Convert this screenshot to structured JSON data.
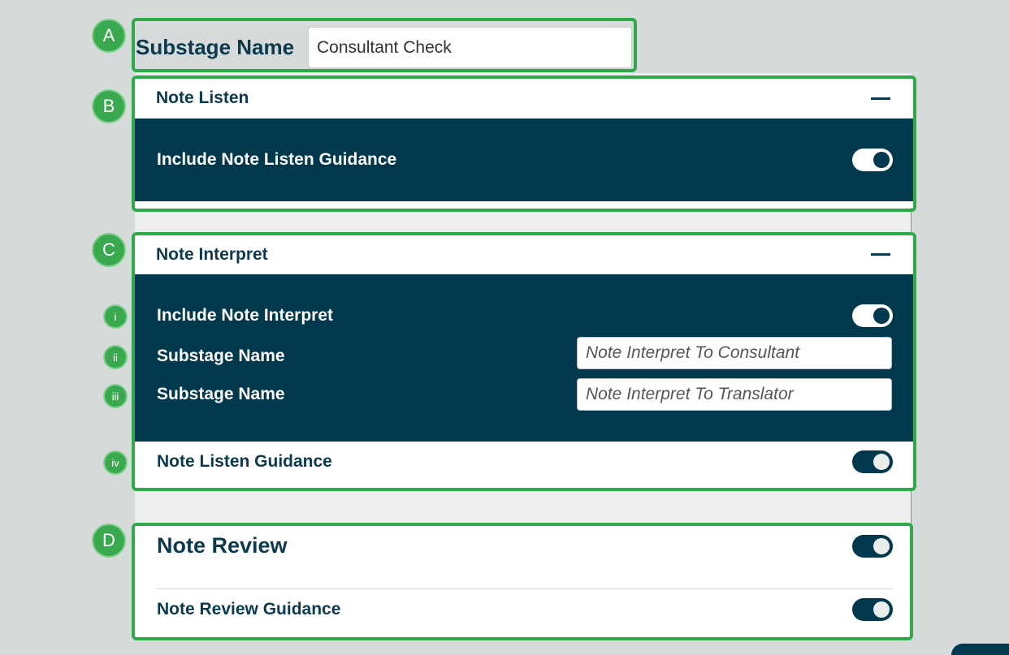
{
  "annotations": {
    "a": "A",
    "b": "B",
    "c": "C",
    "d": "D",
    "c_i": "i",
    "c_ii": "ii",
    "c_iii": "iii",
    "c_iv": "iv"
  },
  "substage": {
    "label": "Substage Name",
    "value": "Consultant Check"
  },
  "note_listen": {
    "title": "Note Listen",
    "toggle_label": "Include Note Listen Guidance",
    "toggle_on": true
  },
  "note_interpret": {
    "title": "Note Interpret",
    "include_label": "Include Note Interpret",
    "include_on": true,
    "substage1_label": "Substage Name",
    "substage1_placeholder": "Note Interpret To Consultant",
    "substage2_label": "Substage Name",
    "substage2_placeholder": "Note Interpret To Translator",
    "guidance_label": "Note Listen Guidance",
    "guidance_on": true
  },
  "note_review": {
    "title": "Note Review",
    "title_on": true,
    "guidance_label": "Note Review Guidance",
    "guidance_on": true
  },
  "colors": {
    "frame": "#2faa4a",
    "badge": "#3aa84f",
    "dark_panel": "#00384d",
    "text": "#0b3a4e",
    "background": "#d6dadb"
  }
}
